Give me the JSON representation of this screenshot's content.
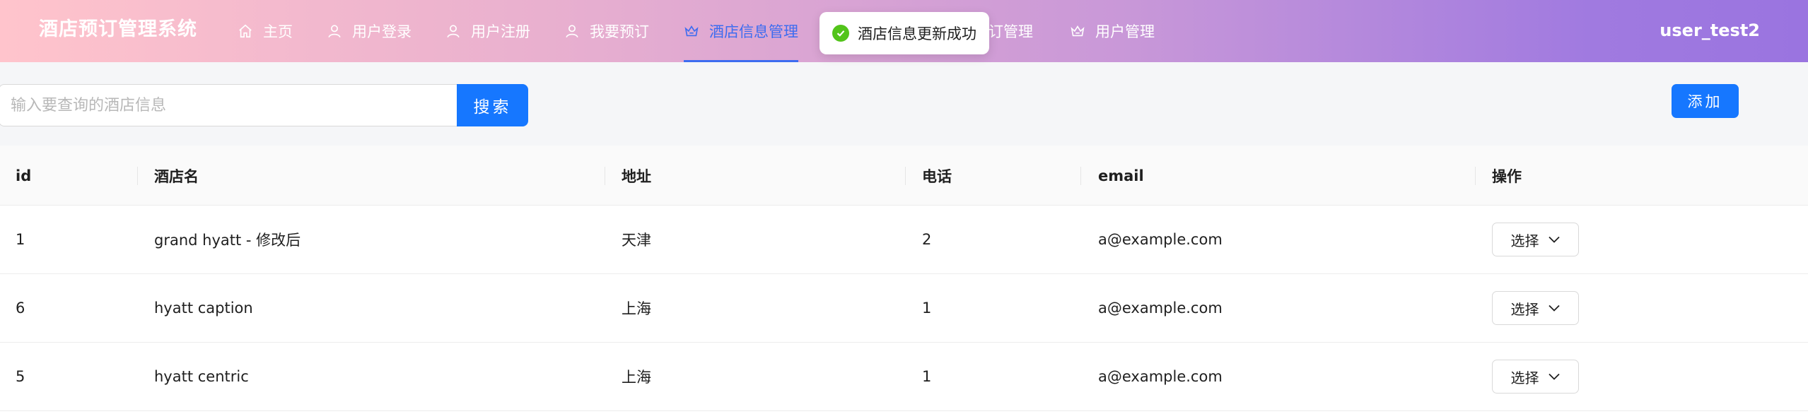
{
  "header": {
    "brand": "酒店预订管理系统",
    "user": "user_test2",
    "nav": [
      {
        "label": "主页",
        "icon": "home-icon"
      },
      {
        "label": "用户登录",
        "icon": "user-icon"
      },
      {
        "label": "用户注册",
        "icon": "user-icon"
      },
      {
        "label": "我要预订",
        "icon": "user-icon"
      },
      {
        "label": "酒店信息管理",
        "icon": "crown-icon",
        "active": true
      },
      {
        "label": "订管理",
        "icon": "none"
      },
      {
        "label": "用户管理",
        "icon": "crown-icon"
      }
    ]
  },
  "toast": {
    "message": "酒店信息更新成功",
    "icon": "check-circle-icon"
  },
  "toolbar": {
    "search_placeholder": "输入要查询的酒店信息",
    "search_value": "",
    "search_label": "搜索",
    "add_label": "添加"
  },
  "table": {
    "columns": [
      "id",
      "酒店名",
      "地址",
      "电话",
      "email",
      "操作"
    ],
    "rows": [
      {
        "id": "1",
        "name": "grand hyatt - 修改后",
        "address": "天津",
        "phone": "2",
        "email": "a@example.com",
        "action": "选择"
      },
      {
        "id": "6",
        "name": "hyatt caption",
        "address": "上海",
        "phone": "1",
        "email": "a@example.com",
        "action": "选择"
      },
      {
        "id": "5",
        "name": "hyatt centric",
        "address": "上海",
        "phone": "1",
        "email": "a@example.com",
        "action": "选择"
      }
    ]
  },
  "colors": {
    "primary": "#1677ff",
    "active_nav": "#3d6cf0",
    "success": "#52c41a"
  }
}
